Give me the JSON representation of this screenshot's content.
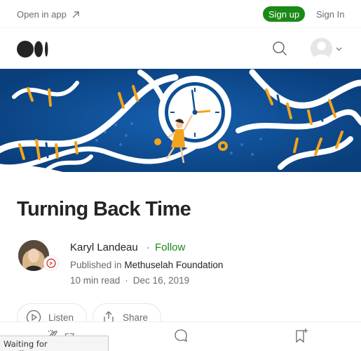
{
  "topbar": {
    "open_app": "Open in app",
    "signup": "Sign up",
    "signin": "Sign In"
  },
  "icons": {
    "open_app": "arrow-up-right-icon",
    "logo": "medium-logo-icon",
    "search": "search-icon",
    "avatar": "user-avatar-icon",
    "chevron": "chevron-down-icon",
    "listen": "play-icon",
    "share": "share-icon",
    "clap": "clap-icon",
    "comment": "comment-icon",
    "save": "bookmark-add-icon"
  },
  "article": {
    "title": "Turning Back Time",
    "author": "Karyl Landeau",
    "dot": "·",
    "follow": "Follow",
    "published_prefix": "Published in",
    "publication": "Methuselah Foundation",
    "read_time": "10 min read",
    "sep": "·",
    "date": "Dec 16, 2019"
  },
  "actions": {
    "listen": "Listen",
    "share": "Share"
  },
  "bottombar": {
    "clap_count": "57"
  },
  "status": {
    "text": "Waiting for medium.com..."
  },
  "colors": {
    "accent": "#1a8917",
    "hero_bg": "#0b4a8c",
    "hero_orange": "#f3a31b"
  }
}
